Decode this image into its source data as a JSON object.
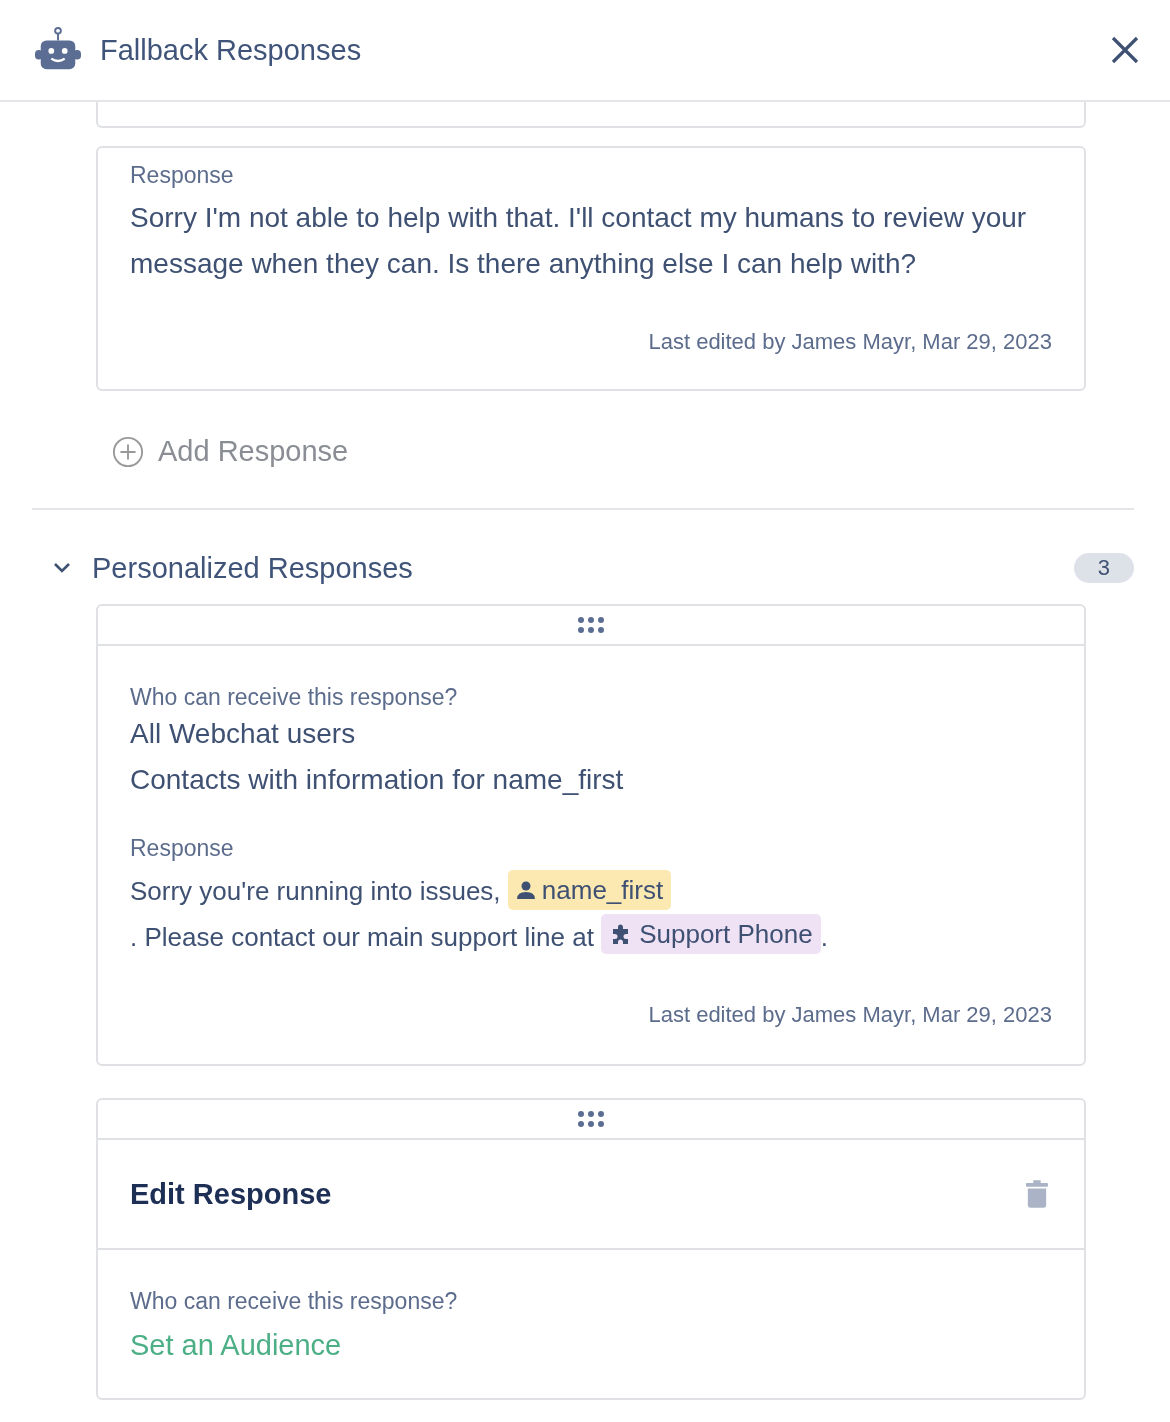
{
  "header": {
    "title": "Fallback Responses"
  },
  "default_response": {
    "label": "Response",
    "text": "Sorry I'm not able to help with that. I'll contact my humans to review your message when they can. Is there anything else I can help with?",
    "edited": "Last edited by James Mayr, Mar 29, 2023"
  },
  "add_response": {
    "label": "Add Response"
  },
  "personalized": {
    "title": "Personalized Responses",
    "expanded": true,
    "count": "3",
    "cards": [
      {
        "kind": "view",
        "audience_label": "Who can receive this response?",
        "audiences": [
          "All Webchat users",
          "Contacts with information for name_first"
        ],
        "response_label": "Response",
        "segments": [
          {
            "kind": "text",
            "text": "Sorry you're running into issues, "
          },
          {
            "kind": "contact_field",
            "text": "name_first"
          },
          {
            "kind": "text",
            "text": ". Please contact our"
          },
          {
            "kind": "text",
            "text": " main support line at "
          },
          {
            "kind": "custom_field",
            "text": "Support Phone"
          },
          {
            "kind": "text",
            "text": "."
          }
        ],
        "edited": "Last edited by James Mayr, Mar 29, 2023"
      },
      {
        "kind": "edit",
        "title": "Edit Response",
        "audience_label": "Who can receive this response?",
        "audience_action": "Set an Audience"
      }
    ]
  }
}
